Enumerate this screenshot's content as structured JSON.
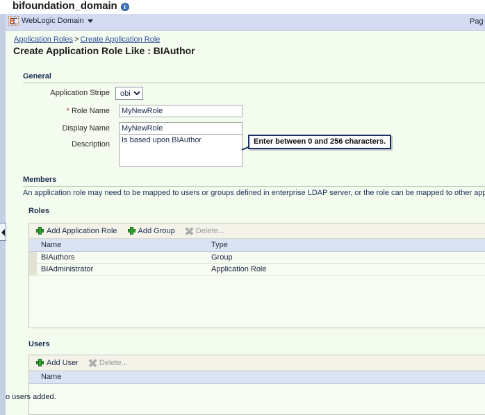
{
  "header": {
    "app_title": "bifoundation_domain",
    "info_icon": "info-icon",
    "context_icon": "weblogic-server-icon",
    "context_label": "WebLogic Domain",
    "context_caret": "caret-down-icon",
    "right_text": "Pag"
  },
  "breadcrumb": {
    "parent": "Application Roles",
    "separator": ">",
    "current": "Create Application Role"
  },
  "page_title": "Create Application Role Like : BIAuthor",
  "general": {
    "heading": "General",
    "application_stripe": {
      "label": "Application Stripe",
      "value": "obi",
      "options": [
        "obi"
      ]
    },
    "role_name": {
      "label": "Role Name",
      "required_marker": "*",
      "value": "MyNewRole",
      "placeholder": ""
    },
    "display_name": {
      "label": "Display Name",
      "value": "MyNewRole",
      "placeholder": ""
    },
    "description": {
      "label": "Description",
      "value": "Is based upon BIAuthor",
      "placeholder": ""
    }
  },
  "tooltip": {
    "text": "Enter between 0 and 256 characters."
  },
  "members": {
    "heading": "Members",
    "description": "An application role may need to be mapped to users or groups defined in enterprise LDAP server, or the role can be mapped to other applic",
    "roles": {
      "heading": "Roles",
      "toolbar": {
        "add_application_role": "Add Application Role",
        "add_group": "Add Group",
        "delete": "Delete...",
        "delete_disabled": true
      },
      "columns": [
        "Name",
        "Type"
      ],
      "rows": [
        {
          "name": "BIAuthors",
          "type": "Group"
        },
        {
          "name": "BIAdministrator",
          "type": "Application Role"
        }
      ]
    },
    "users": {
      "heading": "Users",
      "toolbar": {
        "add_user": "Add User",
        "delete": "Delete...",
        "delete_disabled": true
      },
      "columns": [
        "Name"
      ],
      "rows": [],
      "empty_message": "No users added."
    }
  },
  "colors": {
    "page_background": "#f4fbef",
    "context_band": "#d4dbf0",
    "table_header": "#dbe3f3",
    "accent_link": "#2b4d9b",
    "plus_green": "#35a635",
    "tooltip_border": "#1b2f63"
  }
}
